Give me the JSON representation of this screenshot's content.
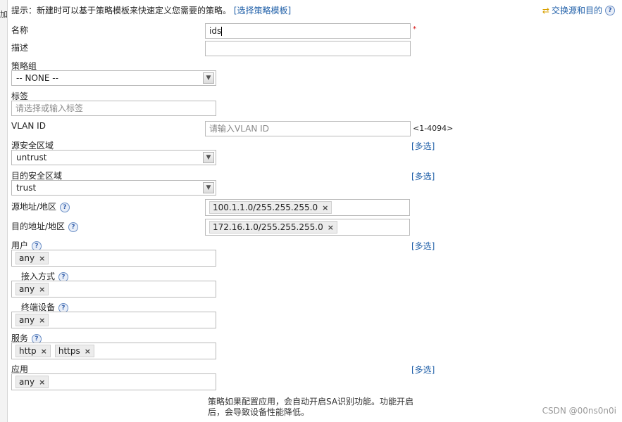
{
  "hint": {
    "prefix": "提示：新建时可以基于策略模板来快速定义您需要的策略。",
    "link": "[选择策略模板]"
  },
  "left_strip_char": "加",
  "swap": {
    "label": "交换源和目的",
    "icon": "swap-icon"
  },
  "fields": {
    "name": {
      "label": "名称",
      "value": "ids",
      "required": "*"
    },
    "desc": {
      "label": "描述",
      "value": ""
    },
    "policy_group": {
      "label": "策略组",
      "selected": "-- NONE --"
    },
    "tag": {
      "label": "标签",
      "placeholder": "请选择或输入标签"
    },
    "vlan": {
      "label": "VLAN ID",
      "placeholder": "请输入VLAN ID",
      "range": "<1-4094>"
    },
    "src_zone": {
      "label": "源安全区域",
      "selected": "untrust",
      "multi": "[多选]"
    },
    "dst_zone": {
      "label": "目的安全区域",
      "selected": "trust",
      "multi": "[多选]"
    },
    "src_addr": {
      "label": "源地址/地区",
      "tags": [
        "100.1.1.0/255.255.255.0"
      ]
    },
    "dst_addr": {
      "label": "目的地址/地区",
      "tags": [
        "172.16.1.0/255.255.255.0"
      ]
    },
    "user": {
      "label": "用户",
      "tags": [
        "any"
      ],
      "multi": "[多选]"
    },
    "access": {
      "label": "接入方式",
      "tags": [
        "any"
      ]
    },
    "device": {
      "label": "终端设备",
      "tags": [
        "any"
      ]
    },
    "service": {
      "label": "服务",
      "tags": [
        "http",
        "https"
      ]
    },
    "app": {
      "label": "应用",
      "tags": [
        "any"
      ],
      "multi": "[多选]"
    }
  },
  "note": "策略如果配置应用，会自动开启SA识别功能。功能开启后，会导致设备性能降低。",
  "watermark": "CSDN @00ns0n0i",
  "help_glyph": "?",
  "tag_close_glyph": "×",
  "select_arrow_glyph": "▼"
}
